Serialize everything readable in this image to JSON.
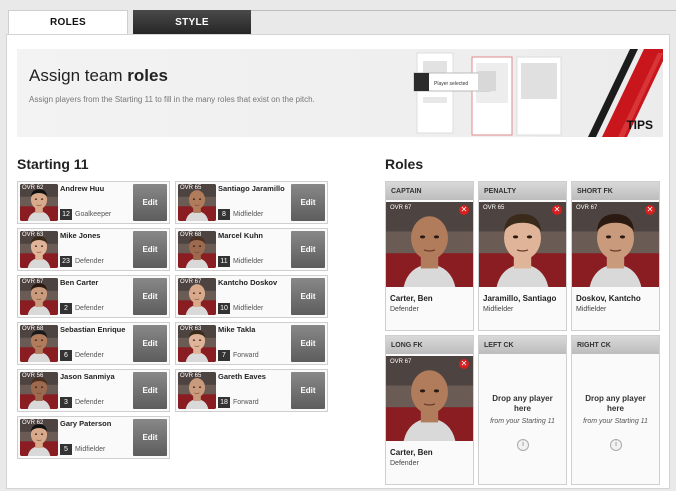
{
  "tabs": [
    {
      "label": "ROLES",
      "active": true
    },
    {
      "label": "STYLE",
      "active": false
    }
  ],
  "banner": {
    "title_prefix": "Assign team ",
    "title_bold": "roles",
    "subtitle": "Assign players from the Starting 11 to fill in the many roles that exist on the pitch.",
    "tips_label": "TIPS",
    "demo_popup": "Player selected"
  },
  "starting": {
    "title": "Starting 11",
    "edit_label": "Edit",
    "players": [
      {
        "ovr": "OVR 62",
        "name": "Andrew Huu",
        "num": "12",
        "pos": "Goalkeeper"
      },
      {
        "ovr": "OVR 65",
        "name": "Santiago Jaramillo",
        "num": "8",
        "pos": "Midfielder"
      },
      {
        "ovr": "OVR 63",
        "name": "Mike Jones",
        "num": "23",
        "pos": "Defender"
      },
      {
        "ovr": "OVR 68",
        "name": "Marcel Kuhn",
        "num": "11",
        "pos": "Midfielder"
      },
      {
        "ovr": "OVR 67",
        "name": "Ben Carter",
        "num": "2",
        "pos": "Defender"
      },
      {
        "ovr": "OVR 67",
        "name": "Kantcho Doskov",
        "num": "10",
        "pos": "Midfielder"
      },
      {
        "ovr": "OVR 68",
        "name": "Sebastian Enrique",
        "num": "6",
        "pos": "Defender"
      },
      {
        "ovr": "OVR 63",
        "name": "Mike Takla",
        "num": "7",
        "pos": "Forward"
      },
      {
        "ovr": "OVR 56",
        "name": "Jason Sanmiya",
        "num": "3",
        "pos": "Defender"
      },
      {
        "ovr": "OVR 65",
        "name": "Gareth Eaves",
        "num": "18",
        "pos": "Forward"
      },
      {
        "ovr": "OVR 62",
        "name": "Gary Paterson",
        "num": "5",
        "pos": "Midfielder"
      }
    ]
  },
  "roles": {
    "title": "Roles",
    "remove_icon": "✕",
    "drop_text": "Drop any player here",
    "drop_from": "from your Starting 11",
    "info_icon": "i",
    "slots": [
      {
        "head": "CAPTAIN",
        "ovr": "OVR 67",
        "name": "Carter, Ben",
        "pos": "Defender",
        "filled": true
      },
      {
        "head": "PENALTY",
        "ovr": "OVR 65",
        "name": "Jaramillo, Santiago",
        "pos": "Midfielder",
        "filled": true
      },
      {
        "head": "SHORT FK",
        "ovr": "OVR 67",
        "name": "Doskov, Kantcho",
        "pos": "Midfielder",
        "filled": true
      },
      {
        "head": "LONG FK",
        "ovr": "OVR 67",
        "name": "Carter, Ben",
        "pos": "Defender",
        "filled": true
      },
      {
        "head": "LEFT CK",
        "filled": false
      },
      {
        "head": "RIGHT CK",
        "filled": false
      }
    ]
  }
}
